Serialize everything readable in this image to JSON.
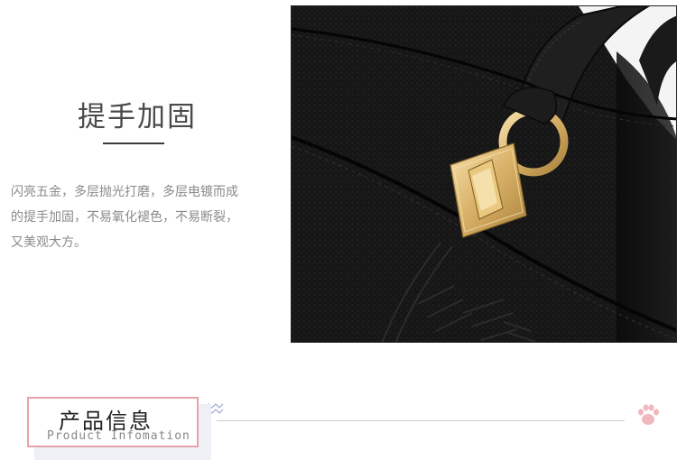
{
  "feature": {
    "title": "提手加固",
    "description": [
      "闪亮五金，多层抛光打磨，多层电镀而成",
      "的提手加固，不易氧化褪色，不易断裂，",
      "又美观大方。"
    ]
  },
  "section": {
    "title_cn": "产品信息",
    "title_en": "Product Infomation"
  },
  "icons": {
    "decoration": "zigzag-lines-icon",
    "paw": "paw-print-icon"
  },
  "colors": {
    "accent_pink": "#e8a3a8",
    "accent_blue": "#a9b7d6",
    "text_dark": "#4a4a4a",
    "text_muted": "#8a8a8a",
    "leather": "#131313",
    "gold": "#e2c27a"
  }
}
